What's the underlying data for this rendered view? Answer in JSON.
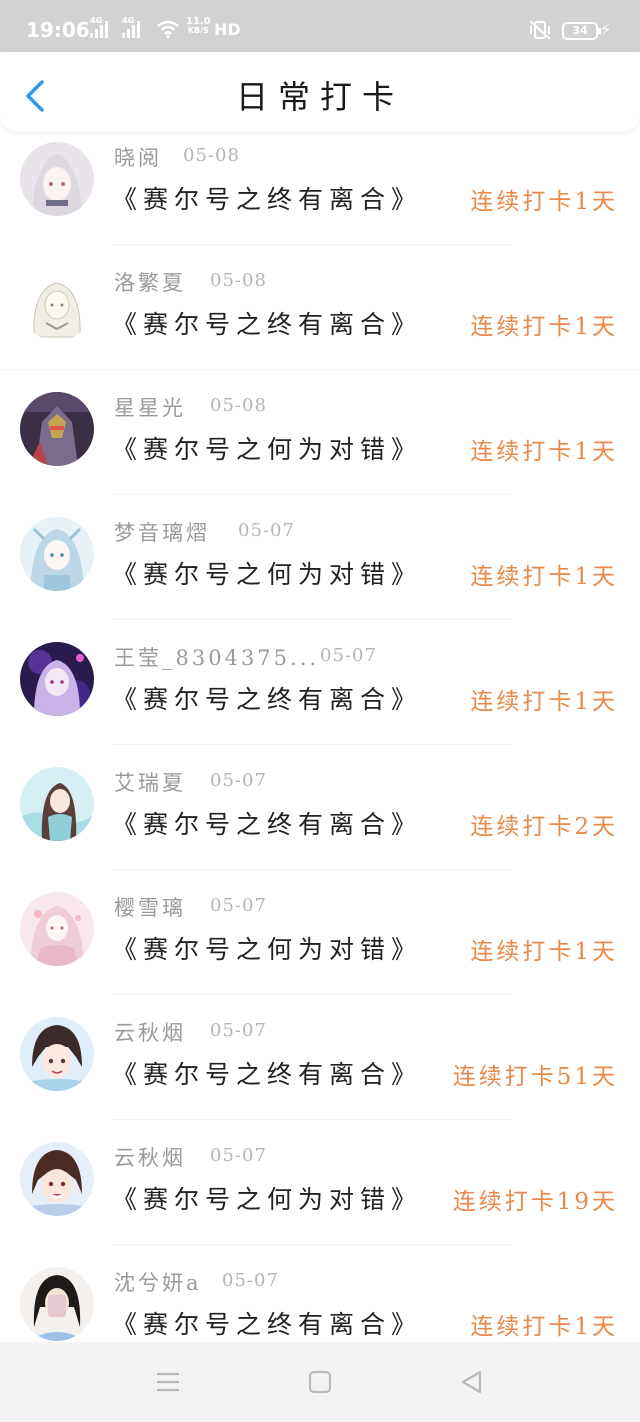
{
  "status_bar": {
    "time": "19:06",
    "network1": "4G",
    "network2": "4G",
    "speed_value": "11.0",
    "speed_unit": "KB/S",
    "hd": "HD",
    "battery": "34"
  },
  "header": {
    "title": "日常打卡",
    "back_icon": "chevron-left-icon"
  },
  "colors": {
    "accent_blue": "#2f9bf0",
    "streak_orange": "#e8894a"
  },
  "checkins": [
    {
      "name": "晓阅",
      "date": "05-08",
      "book": "《赛尔号之终有离合》",
      "streak": "连续打卡1天"
    },
    {
      "name": "洛繁夏",
      "date": "05-08",
      "book": "《赛尔号之终有离合》",
      "streak": "连续打卡1天"
    },
    {
      "name": "星星光",
      "date": "05-08",
      "book": "《赛尔号之何为对错》",
      "streak": "连续打卡1天"
    },
    {
      "name": "梦音璃熠",
      "date": "05-07",
      "book": "《赛尔号之何为对错》",
      "streak": "连续打卡1天"
    },
    {
      "name": "王莹_8304375...",
      "date": "05-07",
      "book": "《赛尔号之终有离合》",
      "streak": "连续打卡1天"
    },
    {
      "name": "艾瑞夏",
      "date": "05-07",
      "book": "《赛尔号之终有离合》",
      "streak": "连续打卡2天"
    },
    {
      "name": "樱雪璃",
      "date": "05-07",
      "book": "《赛尔号之何为对错》",
      "streak": "连续打卡1天"
    },
    {
      "name": "云秋烟",
      "date": "05-07",
      "book": "《赛尔号之终有离合》",
      "streak": "连续打卡51天"
    },
    {
      "name": "云秋烟",
      "date": "05-07",
      "book": "《赛尔号之何为对错》",
      "streak": "连续打卡19天"
    },
    {
      "name": "沈兮妍a",
      "date": "05-07",
      "book": "《赛尔号之终有离合》",
      "streak": "连续打卡1天"
    }
  ],
  "nav": {
    "menu_icon": "menu-icon",
    "home_icon": "square-home-icon",
    "back_icon": "triangle-back-icon"
  }
}
